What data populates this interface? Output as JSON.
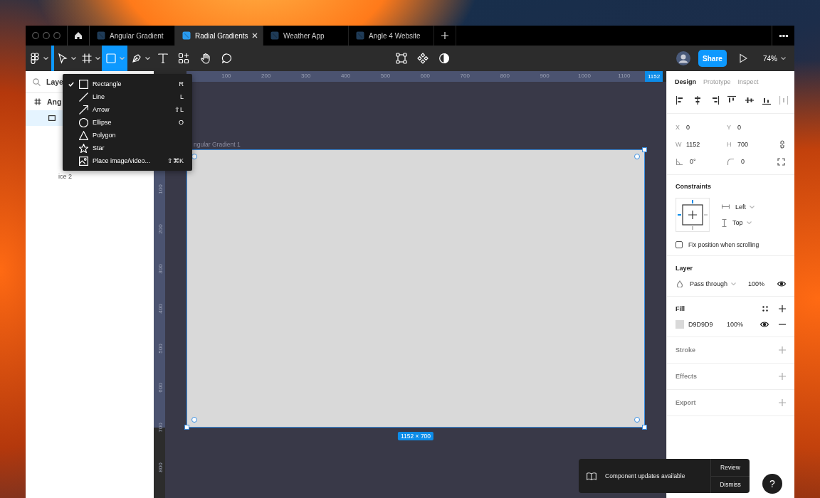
{
  "tabs": [
    {
      "label": "Angular Gradient",
      "selected": false
    },
    {
      "label": "Radial Gradients",
      "selected": true
    },
    {
      "label": "Weather App",
      "selected": false
    },
    {
      "label": "Angle 4 Website",
      "selected": false
    }
  ],
  "toolbar": {
    "tools": [
      {
        "kind": "main-menu",
        "caret": true,
        "selected": false
      },
      {
        "kind": "move",
        "caret": true,
        "selected": false
      },
      {
        "kind": "frame",
        "caret": true,
        "selected": false
      },
      {
        "kind": "shape",
        "caret": true,
        "selected": true
      },
      {
        "kind": "pen",
        "caret": true,
        "selected": false
      },
      {
        "kind": "text",
        "caret": false,
        "selected": false
      },
      {
        "kind": "resources",
        "caret": false,
        "selected": false
      },
      {
        "kind": "hand",
        "caret": false,
        "selected": false
      },
      {
        "kind": "comment",
        "caret": false,
        "selected": false
      }
    ],
    "center_tools": [
      {
        "kind": "frame-corners"
      },
      {
        "kind": "component"
      },
      {
        "kind": "contrast"
      }
    ],
    "share_button": "Share",
    "zoom": "74%"
  },
  "layers_panel": {
    "search": "Laye",
    "items": [
      {
        "kind": "frame",
        "label": "Ang",
        "selected": false
      },
      {
        "kind": "rectangle",
        "selected": true
      }
    ],
    "page_label": "ice 2"
  },
  "shape_menu": {
    "items": [
      {
        "kind": "rectangle",
        "label": "Rectangle",
        "shortcut": "R",
        "checked": true
      },
      {
        "kind": "line",
        "label": "Line",
        "shortcut": "L",
        "checked": false
      },
      {
        "kind": "arrow",
        "label": "Arrow",
        "shortcut": "⇧L",
        "checked": false
      },
      {
        "kind": "ellipse",
        "label": "Ellipse",
        "shortcut": "O",
        "checked": false
      },
      {
        "kind": "polygon",
        "label": "Polygon",
        "checked": false
      },
      {
        "kind": "star",
        "label": "Star",
        "checked": false
      },
      {
        "kind": "image",
        "label": "Place image/video...",
        "shortcut": "⇧⌘K",
        "checked": false
      }
    ]
  },
  "canvas": {
    "top_ruler": {
      "labels": [
        "100",
        "200",
        "300",
        "400",
        "500",
        "600",
        "700",
        "800",
        "900",
        "1000",
        "1100"
      ],
      "end_label": "1152"
    },
    "left_ruler": {
      "labels": [
        "100",
        "200",
        "300",
        "400",
        "500",
        "600",
        "700",
        "800"
      ]
    },
    "frame": {
      "label": "ngular Gradient 1",
      "selected": true,
      "size_badge": "1152 × 700"
    }
  },
  "design_panel": {
    "tabs": [
      {
        "label": "Design",
        "selected": true
      },
      {
        "label": "Prototype",
        "selected": false
      },
      {
        "label": "Inspect",
        "selected": false
      }
    ],
    "fields": [
      {
        "kind": "letter",
        "label": "X",
        "value": "0"
      },
      {
        "kind": "letter",
        "label": "Y",
        "value": "0"
      },
      {
        "kind": "letter",
        "label": "W",
        "value": "1152"
      },
      {
        "kind": "letter",
        "label": "H",
        "value": "700"
      },
      {
        "kind": "rotation",
        "value": "0°"
      },
      {
        "kind": "radius",
        "value": "0"
      }
    ],
    "constraints": {
      "title": "Constraints",
      "horizontal": "Left",
      "vertical": "Top",
      "fix_position": {
        "label": "Fix position when scrolling",
        "checked": false
      }
    },
    "layer": {
      "title": "Layer",
      "blend": "Pass through",
      "opacity": "100%"
    },
    "fill": {
      "title": "Fill",
      "items": [
        {
          "color": "#d9d9d9",
          "hex": "D9D9D9",
          "opacity": "100%"
        }
      ]
    },
    "sections": [
      {
        "title": "Stroke"
      },
      {
        "title": "Effects"
      },
      {
        "title": "Export"
      }
    ]
  },
  "toast": {
    "message": "Component updates available",
    "actions": [
      "Review",
      "Dismiss"
    ]
  },
  "help_button": "?"
}
